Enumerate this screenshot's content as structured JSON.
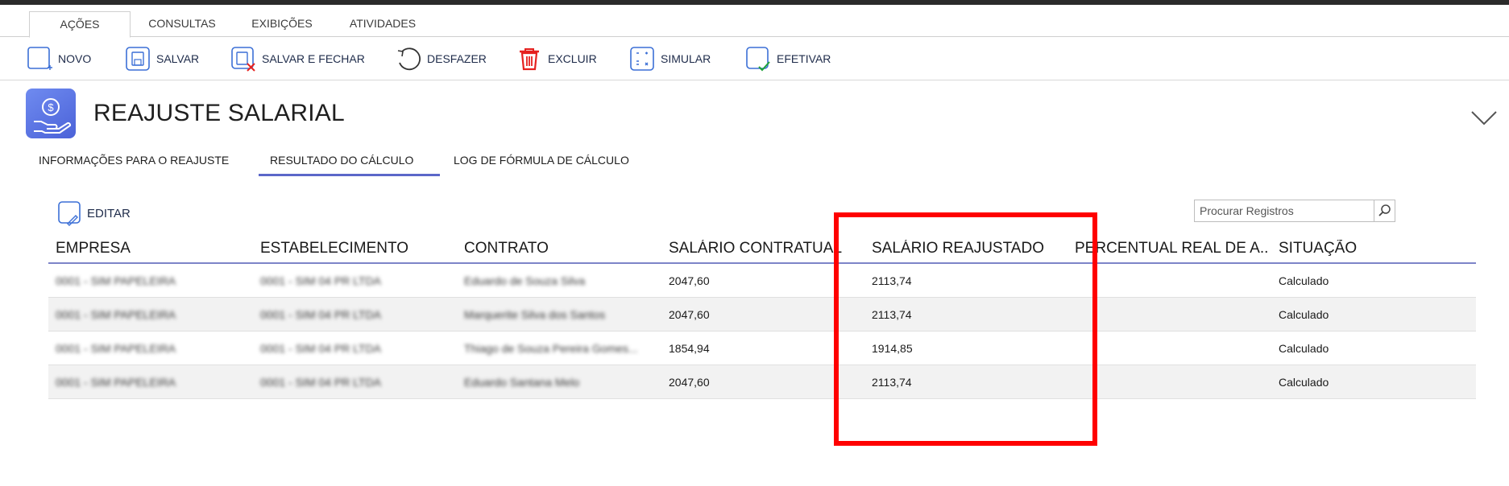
{
  "ribbon": {
    "tabs": [
      "AÇÕES",
      "CONSULTAS",
      "EXIBIÇÕES",
      "ATIVIDADES"
    ]
  },
  "toolbar": {
    "novo": "NOVO",
    "salvar": "SALVAR",
    "salvar_fechar": "SALVAR E FECHAR",
    "desfazer": "DESFAZER",
    "excluir": "EXCLUIR",
    "simular": "SIMULAR",
    "efetivar": "EFETIVAR"
  },
  "page": {
    "title": "REAJUSTE SALARIAL"
  },
  "subtabs": {
    "info": "INFORMAÇÕES PARA O REAJUSTE",
    "resultado": "RESULTADO DO CÁLCULO",
    "log": "LOG DE FÓRMULA DE CÁLCULO",
    "active": "RESULTADO DO CÁLCULO"
  },
  "grid_toolbar": {
    "edit_label": "EDITAR",
    "search_placeholder": "Procurar Registros"
  },
  "table": {
    "columns": [
      "EMPRESA",
      "ESTABELECIMENTO",
      "CONTRATO",
      "SALÁRIO CONTRATUAL",
      "SALÁRIO REAJUSTADO",
      "PERCENTUAL REAL DE A...",
      "SITUAÇÃO"
    ],
    "rows": [
      {
        "empresa": "0001 - SIM PAPELEIRA",
        "estabelecimento": "0001 - SIM 04 PR LTDA",
        "contrato": "Eduardo de Souza Silva",
        "salario_contratual": "2047,60",
        "salario_reajustado": "2113,74",
        "percentual": "",
        "situacao": "Calculado"
      },
      {
        "empresa": "0001 - SIM PAPELEIRA",
        "estabelecimento": "0001 - SIM 04 PR LTDA",
        "contrato": "Marquerite Silva dos Santos",
        "salario_contratual": "2047,60",
        "salario_reajustado": "2113,74",
        "percentual": "",
        "situacao": "Calculado"
      },
      {
        "empresa": "0001 - SIM PAPELEIRA",
        "estabelecimento": "0001 - SIM 04 PR LTDA",
        "contrato": "Thiago de Souza Pereira Gomes...",
        "salario_contratual": "1854,94",
        "salario_reajustado": "1914,85",
        "percentual": "",
        "situacao": "Calculado"
      },
      {
        "empresa": "0001 - SIM PAPELEIRA",
        "estabelecimento": "0001 - SIM 04 PR LTDA",
        "contrato": "Eduardo Santana Melo",
        "salario_contratual": "2047,60",
        "salario_reajustado": "2113,74",
        "percentual": "",
        "situacao": "Calculado"
      }
    ]
  },
  "colors": {
    "accent": "#5b67c9",
    "highlight": "#ff0000",
    "icon_blue": "#3b6fd6",
    "delete_red": "#e5211f",
    "check_green": "#1fa33a"
  }
}
